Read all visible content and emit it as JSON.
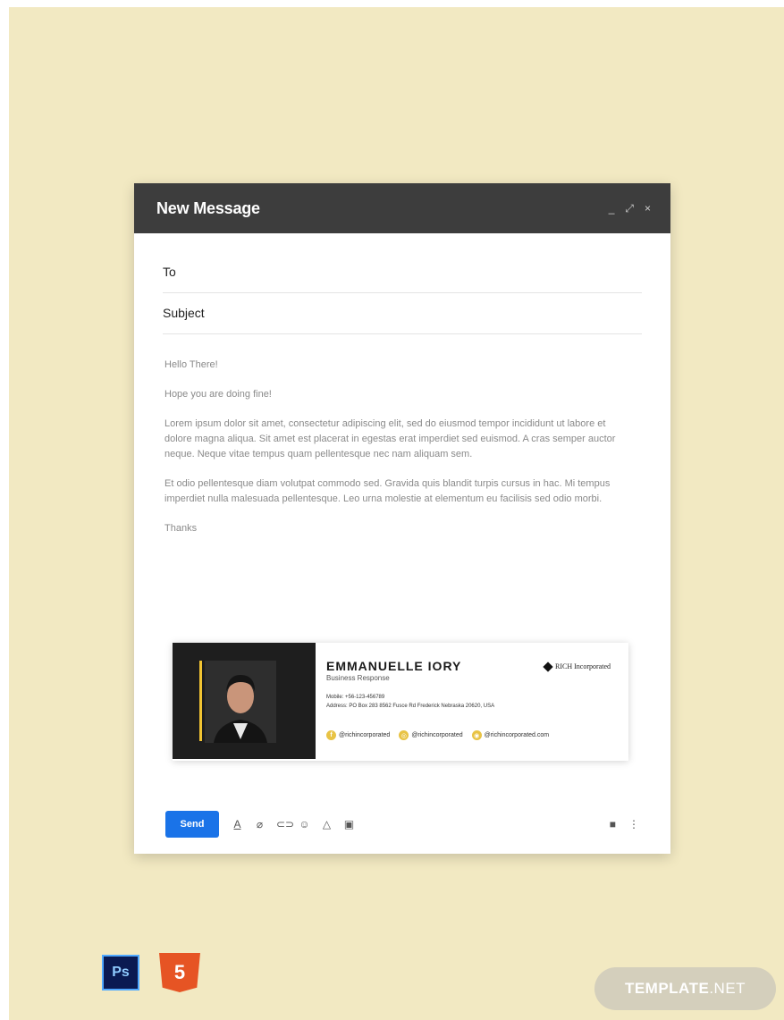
{
  "window": {
    "title": "New Message",
    "controls": {
      "minimize": "_",
      "expand": "⤢",
      "close": "×"
    }
  },
  "fields": {
    "to_label": "To",
    "subject_label": "Subject"
  },
  "body": {
    "greeting": "Hello There!",
    "line1": "Hope you are doing fine!",
    "paragraph1": "Lorem ipsum dolor sit amet, consectetur adipiscing elit, sed do eiusmod tempor incididunt ut labore et dolore magna aliqua. Sit amet est placerat in egestas erat imperdiet sed euismod. A cras semper auctor neque. Neque vitae tempus quam pellentesque nec nam aliquam sem.",
    "paragraph2": " Et odio pellentesque diam volutpat commodo sed. Gravida quis blandit turpis cursus in hac. Mi tempus imperdiet nulla malesuada pellentesque. Leo urna molestie at elementum eu facilisis sed odio morbi.",
    "closing": "Thanks"
  },
  "signature": {
    "name": "EMMANUELLE IORY",
    "role": "Business Response",
    "mobile": "Mobile: +56-123-456789",
    "address": "Address: PO Box 283 8562 Fusce Rd Frederick Nebraska 20620, USA",
    "company": "RICH Incorporated",
    "socials": [
      "@richincorporated",
      "@richincorporated",
      "@richincorporated.com"
    ],
    "accent_color": "#f2c432"
  },
  "toolbar": {
    "send_label": "Send",
    "icons": [
      "format-text-icon",
      "attach-icon",
      "link-icon",
      "emoji-icon",
      "drive-icon",
      "photo-icon",
      "trash-icon",
      "more-options-icon"
    ]
  },
  "badges": {
    "ps": "Ps",
    "html": "5"
  },
  "watermark": {
    "brand": "TEMPLATE",
    "suffix": ".NET"
  },
  "colors": {
    "background": "#f2e9c2",
    "titlebar": "#3d3d3d",
    "send": "#1a73e8"
  }
}
